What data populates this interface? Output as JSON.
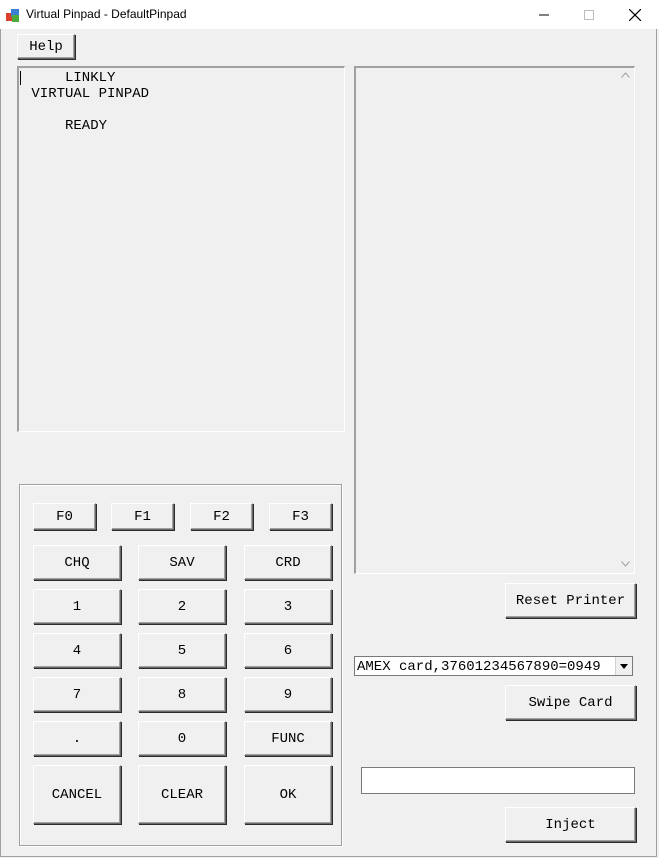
{
  "window": {
    "title": "Virtual Pinpad - DefaultPinpad",
    "minimize_icon": "minimize-icon",
    "maximize_icon": "maximize-icon",
    "close_icon": "close-icon"
  },
  "menu": {
    "help_label": "Help"
  },
  "display": {
    "lines": "     LINKLY\n VIRTUAL PINPAD\n\n     READY"
  },
  "printer": {
    "output": "",
    "reset_label": "Reset Printer"
  },
  "keypad": {
    "function_keys": [
      "F0",
      "F1",
      "F2",
      "F3"
    ],
    "rows": [
      [
        "CHQ",
        "SAV",
        "CRD"
      ],
      [
        "1",
        "2",
        "3"
      ],
      [
        "4",
        "5",
        "6"
      ],
      [
        "7",
        "8",
        "9"
      ],
      [
        ".",
        "0",
        "FUNC"
      ],
      [
        "CANCEL",
        "CLEAR",
        "OK"
      ]
    ]
  },
  "card": {
    "selected": "AMEX card,37601234567890=0949",
    "swipe_label": "Swipe Card"
  },
  "inject": {
    "value": "",
    "label": "Inject"
  }
}
